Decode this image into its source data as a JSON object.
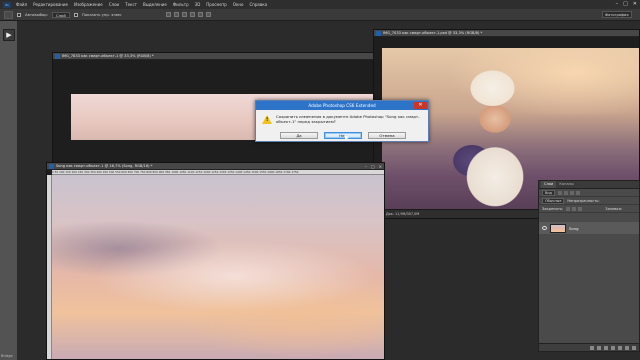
{
  "menubar": {
    "logo": "Ps",
    "items": [
      "Файл",
      "Редактирование",
      "Изображение",
      "Слои",
      "Текст",
      "Выделение",
      "Фильтр",
      "3D",
      "Просмотр",
      "Окно",
      "Справка"
    ],
    "window_controls": [
      "–",
      "□",
      "✕"
    ]
  },
  "options": {
    "auto_select_label": "Автовыбор:",
    "auto_select_value": "Слой",
    "show_controls_label": "Показать упр. элем.",
    "workspace": "Фотография"
  },
  "toolbar": {
    "toggle_glyph": "▶",
    "bridge_label": "Bridge"
  },
  "doc_small": {
    "title": "IMG_7833 как смарт-объект-1 @ 33,3% (RGB/8) *"
  },
  "doc_photo": {
    "title": "IMG_7033 как смарт-объект-1.psd @ 33,3% (RGB/8) *",
    "status": "Док: 11,9M/307,0M"
  },
  "doc_big": {
    "title": "Song как смарт-объект-1 @ 16,7% (Song, RGB/16) *",
    "ruler": "0  50  100  150  200  250  300  350  400  450  500  550  600  650  700  750  800  850  900  950  1000 1050 1100 1150 1200 1250 1300 1350 1400 1450 1500 1550 1600 1650 1700 1750"
  },
  "dialog": {
    "title": "Adobe Photoshop CS6 Extended",
    "message": "Сохранить изменения в документе Adobe Photoshop \"Song как смарт-объект-1\" перед закрытием?",
    "buttons": {
      "yes": "Да",
      "no": "Нет",
      "cancel": "Отмена"
    },
    "icon": "warning-icon"
  },
  "layers_panel": {
    "tabs": [
      "Слои",
      "Каналы"
    ],
    "kind_label": "Вид",
    "blend_mode": "Обычные",
    "opacity_label": "Непрозрачность:",
    "lock_label": "Закрепить:",
    "fill_label": "Заливка:",
    "layer_name": "Song"
  },
  "colors": {
    "dialog_title_bar": "#2d74c9",
    "dialog_close": "#c8362a",
    "app_background": "#2b2b2b"
  }
}
